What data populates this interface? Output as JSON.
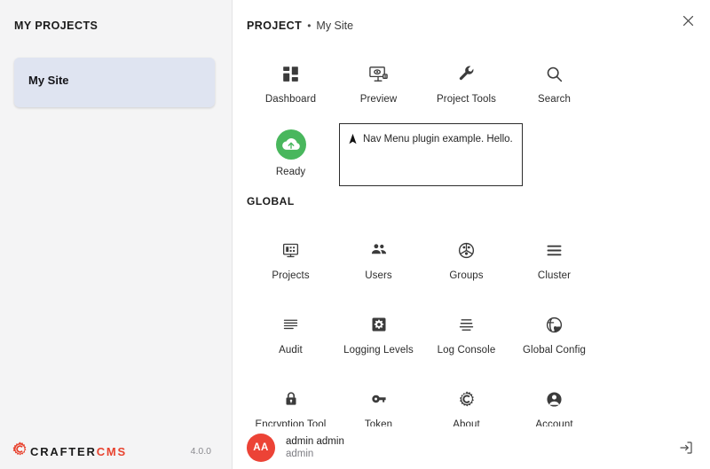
{
  "sidebar": {
    "title": "MY PROJECTS",
    "projects": [
      {
        "name": "My Site",
        "selected": true
      }
    ],
    "footer": {
      "brand_primary": "CRAFTER",
      "brand_secondary": "CMS",
      "version": "4.0.0",
      "logo_color": "#e8432f"
    }
  },
  "header": {
    "breadcrumb_label": "PROJECT",
    "breadcrumb_separator": "•",
    "breadcrumb_site": "My Site",
    "close_icon": "close-icon"
  },
  "project_section": {
    "tools": [
      {
        "label": "Dashboard",
        "icon": "dashboard-grid-icon"
      },
      {
        "label": "Preview",
        "icon": "preview-monitor-eye-icon"
      },
      {
        "label": "Project Tools",
        "icon": "wrench-icon"
      },
      {
        "label": "Search",
        "icon": "search-icon"
      }
    ],
    "status": {
      "label": "Ready",
      "icon": "cloud-upload-icon",
      "color": "#49b75d"
    },
    "plugin_widget": {
      "icon": "navigation-arrow-icon",
      "text": "Nav Menu plugin example. Hello."
    }
  },
  "global_section": {
    "label": "GLOBAL",
    "tools": [
      {
        "label": "Projects",
        "icon": "projects-monitor-icon"
      },
      {
        "label": "Users",
        "icon": "users-group-icon"
      },
      {
        "label": "Groups",
        "icon": "groups-circle-icon"
      },
      {
        "label": "Cluster",
        "icon": "cluster-lines-icon"
      },
      {
        "label": "Audit",
        "icon": "audit-lines-icon"
      },
      {
        "label": "Logging Levels",
        "icon": "logging-gear-box-icon"
      },
      {
        "label": "Log Console",
        "icon": "log-console-lines-icon"
      },
      {
        "label": "Global Config",
        "icon": "globe-icon"
      },
      {
        "label": "Encryption Tool",
        "icon": "lock-icon"
      },
      {
        "label": "Token Management",
        "icon": "key-icon"
      },
      {
        "label": "About",
        "icon": "about-gear-c-icon"
      },
      {
        "label": "Account",
        "icon": "account-person-icon"
      }
    ]
  },
  "user_bar": {
    "initials": "AA",
    "name": "admin admin",
    "handle": "admin",
    "avatar_color": "#ec4336",
    "logout_icon": "logout-icon"
  }
}
